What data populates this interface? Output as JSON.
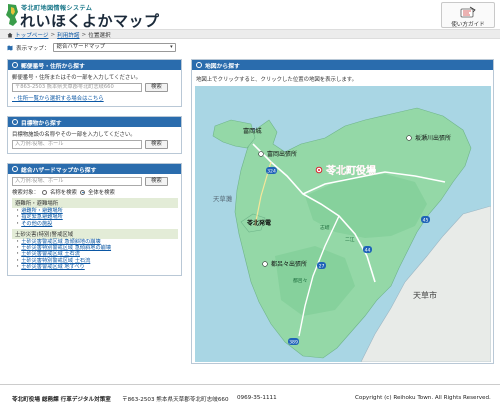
{
  "header": {
    "system_name": "苓北町地図情報システム",
    "title": "れいほくよかマップ",
    "guide_label": "使い方ガイド"
  },
  "breadcrumb": {
    "top": "トップページ",
    "terms": "利用許諾",
    "current": "位置選択",
    "separator": ">"
  },
  "display_map": {
    "label": "表示マップ：",
    "selected": "総合ハザードマップ"
  },
  "postal_panel": {
    "title": "郵便番号・住所から探す",
    "description": "郵便番号・住所またはその一部を入力してください。",
    "placeholder": "〒863-2503 熊本県天草郡苓北町志岐660",
    "search_label": "検索",
    "link": "・住所一覧から選択する場合はこちら"
  },
  "landmark_panel": {
    "title": "目標物から探す",
    "description": "目標物施設の名称やその一部を入力してください。",
    "placeholder": "入力例:役場、ホール",
    "search_label": "検索"
  },
  "hazard_panel": {
    "title": "総合ハザードマップから探す",
    "placeholder": "入力例:役場、ホール",
    "search_label": "検索",
    "target_label": "検索対象：",
    "option_name": "名称を検索",
    "option_all": "全体を検索",
    "categories": [
      {
        "label": "避難所・避難場所",
        "items": [
          "避難所・避難場所",
          "指定緊急避難場所",
          "その他の施設"
        ]
      },
      {
        "label": "土砂災害(特別)警戒区域",
        "items": [
          "土砂災害警戒区域 急傾斜地の崩壊",
          "土砂災害特別警戒区域 急傾斜地の崩壊",
          "土砂災害警戒区域 土石流",
          "土砂災害特別警戒区域 土石流",
          "土砂災害警戒区域 地すべり"
        ]
      }
    ]
  },
  "map_panel": {
    "title": "地図から探す",
    "description": "地図上でクリックすると、クリックした位置の地図を表示します。",
    "labels": {
      "town_hall": "苓北町役場",
      "tomioka_castle": "富岡城",
      "tomioka_branch": "富岡出張所",
      "sakazegawa_branch": "坂瀬川出張所",
      "tsuzuki_branch": "都呂々出張所",
      "amakusanada": "天草灘",
      "reihoku_plant": "苓北発電",
      "amakusa_city": "天草市",
      "route_324": "324",
      "route_389": "389",
      "route_27": "27",
      "route_44": "44",
      "route_45": "45",
      "place_shiki": "志岐",
      "place_tsuzuki": "都呂々",
      "place_futae": "二江"
    }
  },
  "footer": {
    "office": "苓北町役場 総務課 行革デジタル対策室",
    "address": "〒863-2503 熊本県天草郡苓北町志岐660",
    "tel": "0969-35-1111",
    "copyright": "Copyright (c) Reihoku Town. All Rights Reserved."
  },
  "colors": {
    "panel_header": "#2a6cad",
    "link": "#0b57a4",
    "sea": "#a9d6e4",
    "land": "#94d8a7",
    "town_hall": "#d9232d"
  }
}
